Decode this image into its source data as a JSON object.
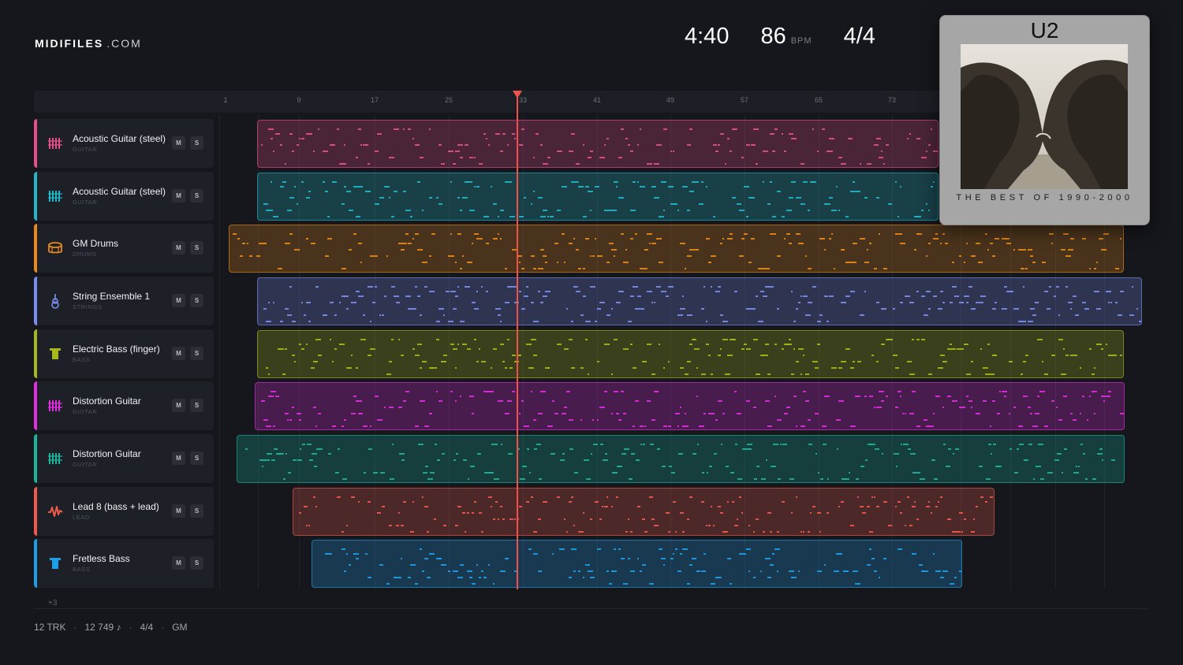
{
  "header": {
    "logo_bold": "MIDIFILES",
    "logo_domain": ".COM",
    "duration": "4:40",
    "tempo": "86",
    "tempo_unit": "BPM",
    "time_signature": "4/4"
  },
  "ruler": {
    "bars": [
      "1",
      "9",
      "17",
      "25",
      "33",
      "41",
      "49",
      "57",
      "65",
      "73"
    ]
  },
  "tracks": [
    {
      "name": "Acoustic Guitar (steel)",
      "category": "GUITAR",
      "color": "#e84f8a",
      "icon": "guitar-fret-icon",
      "mute": "M",
      "solo": "S"
    },
    {
      "name": "Acoustic Guitar (steel)",
      "category": "GUITAR",
      "color": "#22b6c8",
      "icon": "guitar-fret-icon",
      "mute": "M",
      "solo": "S"
    },
    {
      "name": "GM Drums",
      "category": "DRUMS",
      "color": "#e8891a",
      "icon": "drum-icon",
      "mute": "M",
      "solo": "S"
    },
    {
      "name": "String Ensemble 1",
      "category": "STRINGS",
      "color": "#7b8ef0",
      "icon": "violin-icon",
      "mute": "M",
      "solo": "S"
    },
    {
      "name": "Electric Bass (finger)",
      "category": "BASS",
      "color": "#a6b81c",
      "icon": "bass-icon",
      "mute": "M",
      "solo": "S"
    },
    {
      "name": "Distortion Guitar",
      "category": "GUITAR",
      "color": "#de2fe0",
      "icon": "guitar-fret-icon",
      "mute": "M",
      "solo": "S"
    },
    {
      "name": "Distortion Guitar",
      "category": "GUITAR",
      "color": "#19b59c",
      "icon": "guitar-fret-icon",
      "mute": "M",
      "solo": "S"
    },
    {
      "name": "Lead 8 (bass + lead)",
      "category": "LEAD",
      "color": "#ef5a4b",
      "icon": "wave-icon",
      "mute": "M",
      "solo": "S"
    },
    {
      "name": "Fretless Bass",
      "category": "BASS",
      "color": "#1f9ee8",
      "icon": "bass-icon",
      "mute": "M",
      "solo": "S"
    }
  ],
  "more_tracks": "+3",
  "footer": {
    "tracks": "12 TRK",
    "notes": "12 749 ♪",
    "meter": "4/4",
    "standard": "GM"
  },
  "album": {
    "artist": "U2",
    "title": "THE BEST OF 1990-2000"
  }
}
